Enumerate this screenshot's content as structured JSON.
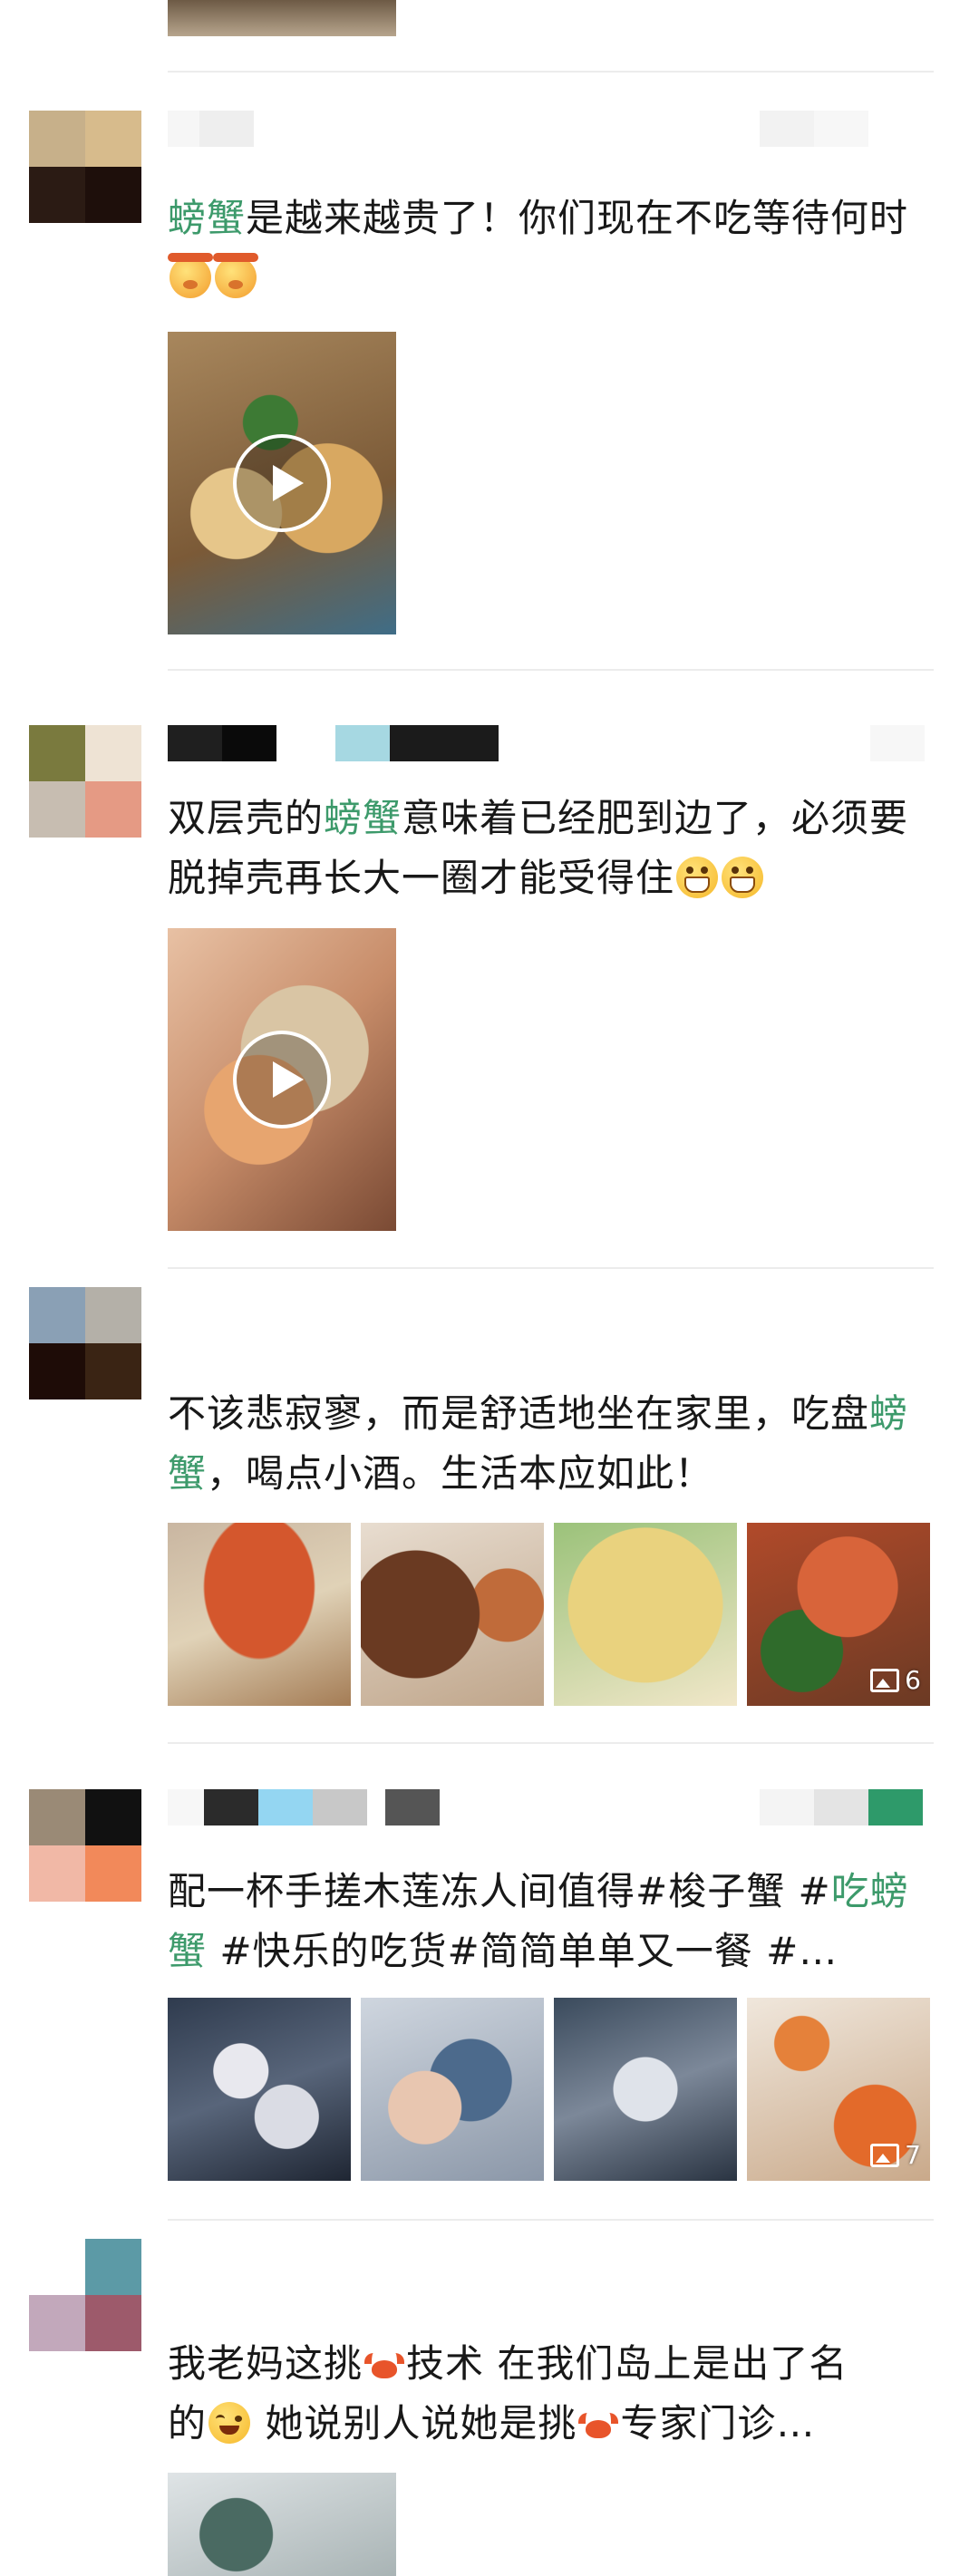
{
  "colors": {
    "keyword": "#3d9a6b",
    "text": "#181818",
    "divider": "#ececec"
  },
  "posts": [
    {
      "text_before": "",
      "keyword": "螃蟹",
      "text_after": "是越来越贵了！你们现在不吃等待何时",
      "emojis": [
        "whisper-face-icon",
        "whisper-face-icon"
      ],
      "media": "video"
    },
    {
      "text_before": "双层壳的",
      "keyword": "螃蟹",
      "text_after": "意味着已经肥到边了，必须要脱掉壳再长大一圈才能受得住",
      "emojis": [
        "grin-face-icon",
        "grin-face-icon"
      ],
      "media": "video"
    },
    {
      "text_before": "不该悲寂寥，而是舒适地坐在家里，吃盘",
      "keyword": "螃蟹",
      "text_after": "，喝点小酒。生活本应如此！",
      "media": "photos",
      "photo_count": "6"
    },
    {
      "text_before": "配一杯手搓木莲冻人间值得#梭子蟹 #",
      "keyword": "吃螃蟹",
      "text_after": " #快乐的吃货#简简单单又一餐 #…",
      "media": "photos",
      "photo_count": "7"
    },
    {
      "line1_before": "我老妈这挑",
      "line1_after": "技术 在我们岛上是出了名",
      "line2_before": "的",
      "line2_mid": " 她说别人说她是挑",
      "line2_after": "专家门诊…",
      "media": "photo"
    }
  ]
}
